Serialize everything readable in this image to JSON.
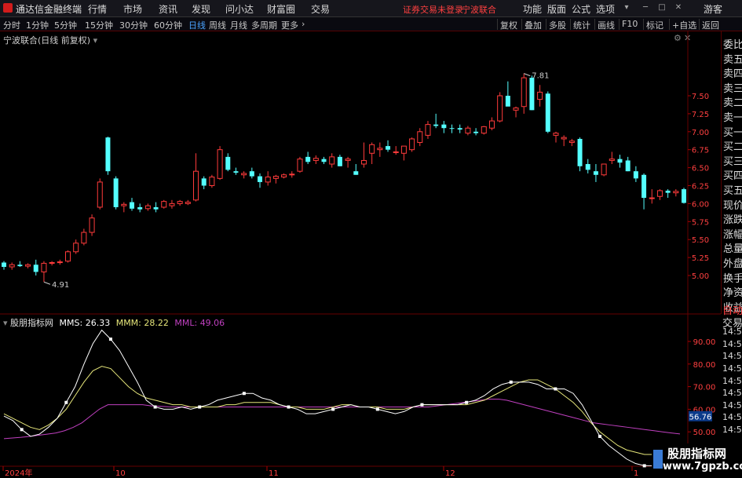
{
  "app": {
    "title": "通达信金融终端",
    "status": "证券交易未登录",
    "stock_link": "宁波联合",
    "guest": "游客"
  },
  "menu": [
    "行情",
    "市场",
    "资讯",
    "发现",
    "问小达",
    "财富圈",
    "交易"
  ],
  "right_menu": [
    "功能",
    "版面",
    "公式",
    "选项"
  ],
  "periods": [
    "分时",
    "1分钟",
    "5分钟",
    "15分钟",
    "30分钟",
    "60分钟",
    "日线",
    "周线",
    "月线",
    "多周期",
    "更多"
  ],
  "active_period": "日线",
  "toolbar_right": [
    "复权",
    "叠加",
    "多股",
    "统计",
    "画线",
    "F10",
    "标记",
    "+自选",
    "返回"
  ],
  "main_header": "宁波联合(日线 前复权)",
  "indicator": {
    "name": "股朋指标网",
    "mms_label": "MMS: 26.33",
    "mmm_label": "MMM: 28.22",
    "mml_label": "MML: 49.06",
    "current_value": "56.76",
    "colors": {
      "mms": "#ffffff",
      "mmm": "#e6e67a",
      "mml": "#c040c0"
    }
  },
  "price_axis": [
    "7.50",
    "7.25",
    "7.00",
    "6.75",
    "6.50",
    "6.25",
    "6.00",
    "5.75",
    "5.50",
    "5.25",
    "5.00"
  ],
  "ind_axis": [
    "90.00",
    "80.00",
    "70.00",
    "60.00",
    "50.00",
    "40.00"
  ],
  "high_label": "7.81",
  "low_label": "4.91",
  "x_labels": [
    "2024年",
    "10",
    "11",
    "12",
    "1"
  ],
  "side_quote": [
    "委比",
    "卖五",
    "卖四",
    "卖三",
    "卖二",
    "卖一",
    "买一",
    "买二",
    "买三",
    "买四",
    "买五",
    "现价",
    "涨跌",
    "涨幅",
    "总量",
    "外盘",
    "换手",
    "净资",
    "收益"
  ],
  "side_lower": [
    "自动",
    "交易",
    "14:55",
    "14:55",
    "14:55",
    "14:55",
    "14:56",
    "14:56",
    "14:56",
    "14:56",
    "14:56"
  ],
  "watermark": {
    "name": "股朋指标网",
    "url": "www.7gpzb.com"
  },
  "chart_data": {
    "type": "candlestick",
    "ohlc": [
      [
        5.18,
        5.2,
        5.08,
        5.12
      ],
      [
        5.12,
        5.18,
        5.08,
        5.15
      ],
      [
        5.15,
        5.2,
        5.12,
        5.13
      ],
      [
        5.13,
        5.17,
        5.1,
        5.15
      ],
      [
        5.15,
        5.22,
        5.0,
        5.05
      ],
      [
        5.05,
        5.2,
        4.91,
        5.17
      ],
      [
        5.17,
        5.2,
        5.14,
        5.18
      ],
      [
        5.18,
        5.22,
        5.15,
        5.19
      ],
      [
        5.2,
        5.35,
        5.18,
        5.33
      ],
      [
        5.33,
        5.5,
        5.3,
        5.45
      ],
      [
        5.45,
        5.65,
        5.42,
        5.6
      ],
      [
        5.6,
        5.85,
        5.55,
        5.8
      ],
      [
        5.95,
        6.35,
        5.92,
        6.3
      ],
      [
        6.92,
        6.93,
        6.4,
        6.45
      ],
      [
        6.35,
        6.38,
        5.92,
        5.95
      ],
      [
        5.97,
        6.02,
        5.88,
        5.99
      ],
      [
        6.02,
        6.08,
        5.9,
        5.93
      ],
      [
        5.95,
        6.0,
        5.88,
        5.92
      ],
      [
        5.93,
        6.0,
        5.9,
        5.97
      ],
      [
        5.95,
        6.02,
        5.88,
        5.92
      ],
      [
        5.95,
        6.05,
        5.93,
        6.03
      ],
      [
        5.97,
        6.05,
        5.93,
        6.0
      ],
      [
        6.0,
        6.05,
        5.97,
        6.03
      ],
      [
        6.0,
        6.05,
        5.98,
        6.02
      ],
      [
        6.05,
        6.7,
        6.03,
        6.45
      ],
      [
        6.35,
        6.38,
        6.2,
        6.25
      ],
      [
        6.25,
        6.4,
        6.22,
        6.37
      ],
      [
        6.35,
        6.8,
        6.33,
        6.75
      ],
      [
        6.65,
        6.7,
        6.45,
        6.47
      ],
      [
        6.45,
        6.5,
        6.4,
        6.43
      ],
      [
        6.4,
        6.45,
        6.35,
        6.42
      ],
      [
        6.45,
        6.5,
        6.35,
        6.38
      ],
      [
        6.38,
        6.42,
        6.22,
        6.3
      ],
      [
        6.3,
        6.45,
        6.25,
        6.37
      ],
      [
        6.35,
        6.4,
        6.28,
        6.38
      ],
      [
        6.37,
        6.42,
        6.35,
        6.4
      ],
      [
        6.4,
        6.45,
        6.36,
        6.41
      ],
      [
        6.45,
        6.65,
        6.43,
        6.62
      ],
      [
        6.65,
        6.72,
        6.55,
        6.58
      ],
      [
        6.6,
        6.67,
        6.55,
        6.63
      ],
      [
        6.62,
        6.65,
        6.55,
        6.58
      ],
      [
        6.55,
        6.7,
        6.5,
        6.65
      ],
      [
        6.65,
        6.68,
        6.52,
        6.52
      ],
      [
        6.6,
        6.65,
        6.5,
        6.62
      ],
      [
        6.45,
        6.55,
        6.4,
        6.4
      ],
      [
        6.55,
        6.85,
        6.5,
        6.6
      ],
      [
        6.7,
        6.85,
        6.55,
        6.82
      ],
      [
        6.75,
        6.85,
        6.65,
        6.77
      ],
      [
        6.8,
        6.88,
        6.72,
        6.75
      ],
      [
        6.72,
        6.8,
        6.68,
        6.72
      ],
      [
        6.7,
        6.8,
        6.6,
        6.8
      ],
      [
        6.75,
        6.92,
        6.72,
        6.9
      ],
      [
        6.85,
        7.05,
        6.8,
        7.0
      ],
      [
        6.95,
        7.15,
        6.9,
        7.1
      ],
      [
        7.1,
        7.25,
        7.05,
        7.08
      ],
      [
        7.1,
        7.15,
        6.98,
        7.05
      ],
      [
        7.05,
        7.1,
        6.98,
        7.04
      ],
      [
        7.05,
        7.1,
        6.98,
        7.03
      ],
      [
        6.98,
        7.08,
        6.95,
        7.05
      ],
      [
        7.0,
        7.05,
        6.95,
        6.98
      ],
      [
        6.98,
        7.08,
        6.96,
        7.07
      ],
      [
        7.05,
        7.2,
        7.02,
        7.15
      ],
      [
        7.15,
        7.55,
        7.13,
        7.5
      ],
      [
        7.5,
        7.7,
        7.45,
        7.35
      ],
      [
        7.3,
        7.35,
        7.2,
        7.33
      ],
      [
        7.35,
        7.81,
        7.25,
        7.75
      ],
      [
        7.75,
        7.78,
        7.3,
        7.3
      ],
      [
        7.45,
        7.65,
        7.35,
        7.55
      ],
      [
        7.53,
        7.56,
        6.98,
        7.0
      ],
      [
        6.95,
        7.0,
        6.85,
        6.98
      ],
      [
        6.9,
        6.95,
        6.8,
        6.92
      ],
      [
        6.85,
        6.9,
        6.8,
        6.87
      ],
      [
        6.9,
        6.92,
        6.45,
        6.52
      ],
      [
        6.55,
        6.62,
        6.42,
        6.47
      ],
      [
        6.45,
        6.55,
        6.3,
        6.4
      ],
      [
        6.4,
        6.55,
        6.38,
        6.55
      ],
      [
        6.6,
        6.72,
        6.55,
        6.62
      ],
      [
        6.62,
        6.68,
        6.5,
        6.57
      ],
      [
        6.6,
        6.65,
        6.45,
        6.45
      ],
      [
        6.45,
        6.52,
        6.3,
        6.35
      ],
      [
        6.4,
        6.42,
        5.92,
        6.08
      ],
      [
        6.07,
        6.2,
        6.0,
        6.08
      ],
      [
        6.1,
        6.2,
        6.05,
        6.18
      ],
      [
        6.18,
        6.2,
        6.08,
        6.15
      ],
      [
        6.15,
        6.2,
        6.1,
        6.17
      ],
      [
        6.2,
        6.22,
        6.0,
        6.01
      ]
    ],
    "mms": [
      57,
      55,
      51,
      48,
      49,
      52,
      56,
      63,
      70,
      80,
      89,
      95,
      91,
      86,
      79,
      72,
      64,
      61,
      60,
      60,
      61,
      60,
      61,
      62,
      64,
      65,
      66,
      67,
      67,
      65,
      64,
      62,
      61,
      60,
      58,
      58,
      59,
      60,
      61,
      62,
      61,
      61,
      60,
      59,
      58,
      59,
      61,
      62,
      62,
      62,
      62,
      62,
      63,
      64,
      66,
      69,
      71,
      72,
      72,
      72,
      71,
      69,
      69,
      69,
      67,
      62,
      55,
      48,
      44,
      41,
      38,
      36,
      35,
      35,
      36,
      36,
      35
    ],
    "mmm": [
      58,
      56,
      54,
      52,
      51,
      53,
      56,
      60,
      66,
      72,
      77,
      79,
      78,
      74,
      70,
      67,
      65,
      64,
      63,
      62,
      62,
      61,
      61,
      61,
      61,
      62,
      62,
      63,
      63,
      63,
      63,
      62,
      61,
      61,
      60,
      60,
      60,
      61,
      62,
      62,
      61,
      61,
      61,
      60,
      60,
      60,
      61,
      62,
      62,
      62,
      62,
      62,
      62,
      63,
      64,
      66,
      68,
      70,
      72,
      73,
      73,
      71,
      69,
      66,
      63,
      59,
      54,
      50,
      47,
      44,
      42,
      41,
      40,
      40,
      39,
      38,
      37
    ],
    "mml": [
      47,
      47.3,
      47.6,
      48,
      48.5,
      49,
      49.5,
      50.5,
      52,
      54,
      57,
      60,
      62,
      62,
      62,
      62,
      62,
      61.5,
      61.3,
      61.1,
      61,
      61,
      61,
      61,
      61,
      61,
      61,
      61,
      61,
      61,
      61,
      61,
      61,
      61,
      61,
      61,
      61,
      61,
      61,
      61,
      61,
      61,
      61,
      61,
      61,
      61,
      61,
      61,
      61,
      61,
      61.5,
      62,
      62.5,
      63,
      63.5,
      64,
      64.5,
      64.5,
      64,
      63,
      62,
      61,
      60,
      59,
      58,
      57,
      56,
      55,
      54,
      53.5,
      53,
      52.5,
      52,
      51.5,
      51,
      50.5,
      50,
      49.5,
      49.06
    ]
  }
}
